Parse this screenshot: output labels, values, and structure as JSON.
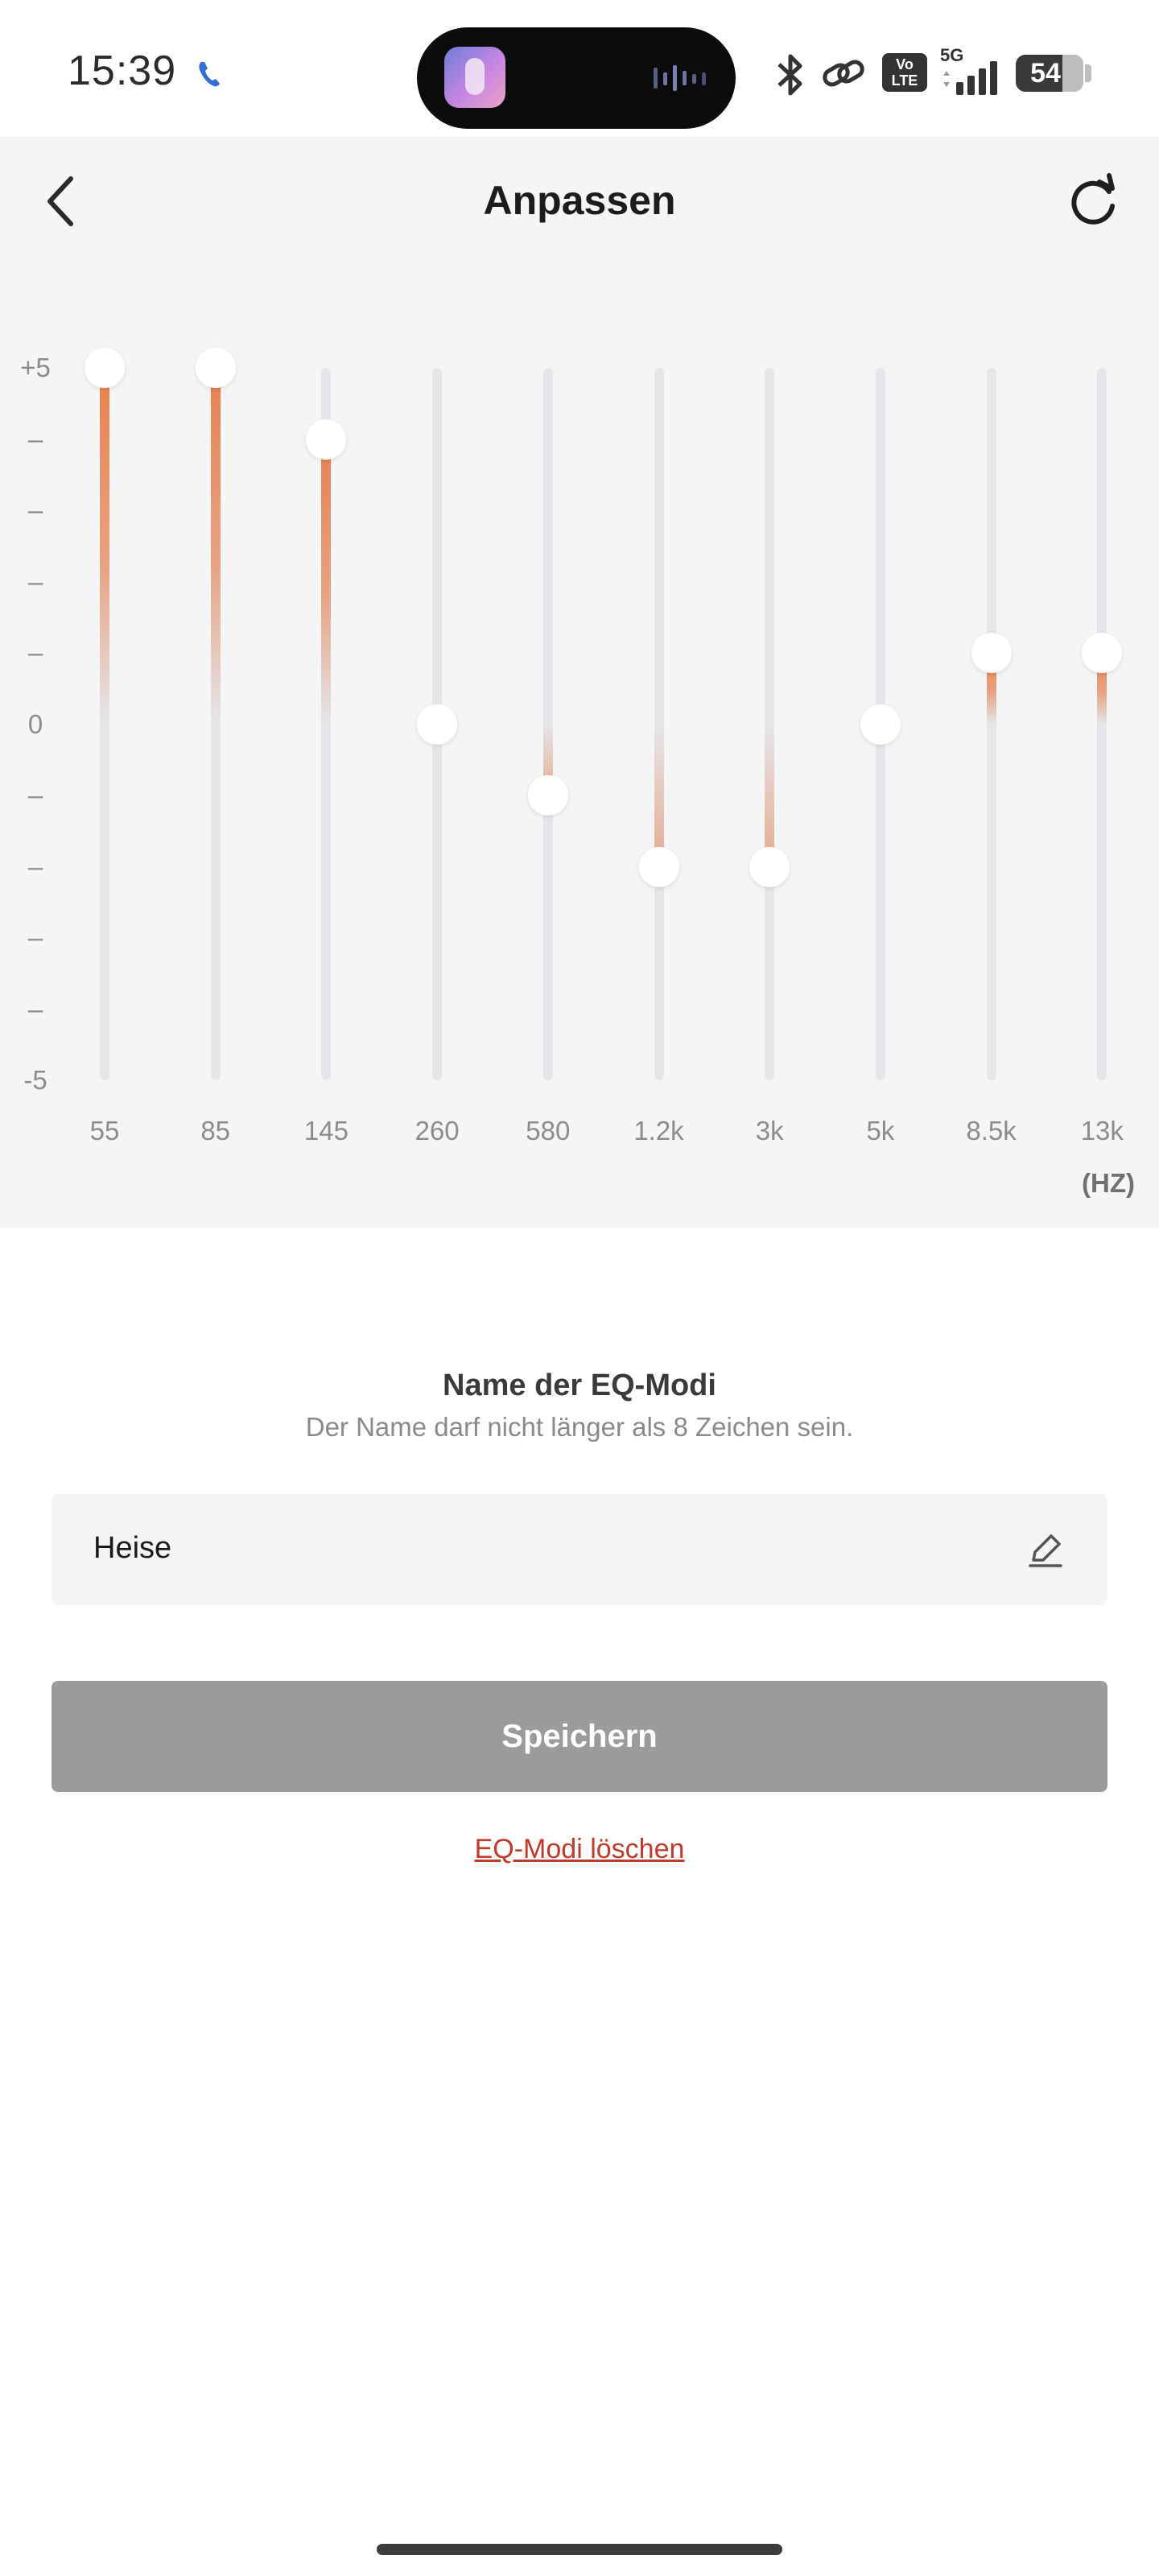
{
  "status_bar": {
    "time": "15:39",
    "battery": "54",
    "network": "5G",
    "volte": "Vo LTE",
    "icons": [
      "phone-icon",
      "bluetooth-icon",
      "link-icon",
      "volte-icon",
      "signal-icon",
      "battery-icon"
    ]
  },
  "header": {
    "title": "Anpassen",
    "back_icon": "chevron-left-icon",
    "reset_icon": "refresh-icon"
  },
  "equalizer": {
    "db_labels": [
      "+5",
      "–",
      "–",
      "–",
      "–",
      "0",
      "–",
      "–",
      "–",
      "–",
      "-5"
    ],
    "range": [
      -5,
      5
    ],
    "unit": "(HZ)",
    "bands": [
      {
        "freq": "55",
        "gain": 5
      },
      {
        "freq": "85",
        "gain": 5
      },
      {
        "freq": "145",
        "gain": 4
      },
      {
        "freq": "260",
        "gain": 0
      },
      {
        "freq": "580",
        "gain": -1
      },
      {
        "freq": "1.2k",
        "gain": -2
      },
      {
        "freq": "3k",
        "gain": -2
      },
      {
        "freq": "5k",
        "gain": 0
      },
      {
        "freq": "8.5k",
        "gain": 1
      },
      {
        "freq": "13k",
        "gain": 1
      }
    ],
    "colors": {
      "accent": "#E8804E",
      "track": "#E6E6EA",
      "knob": "#FFFFFF"
    }
  },
  "name_section": {
    "title": "Name der EQ-Modi",
    "hint": "Der Name darf nicht länger als 8 Zeichen sein.",
    "value": "Heise",
    "edit_icon": "pencil-icon"
  },
  "actions": {
    "save_label": "Speichern",
    "delete_label": "EQ-Modi löschen"
  }
}
